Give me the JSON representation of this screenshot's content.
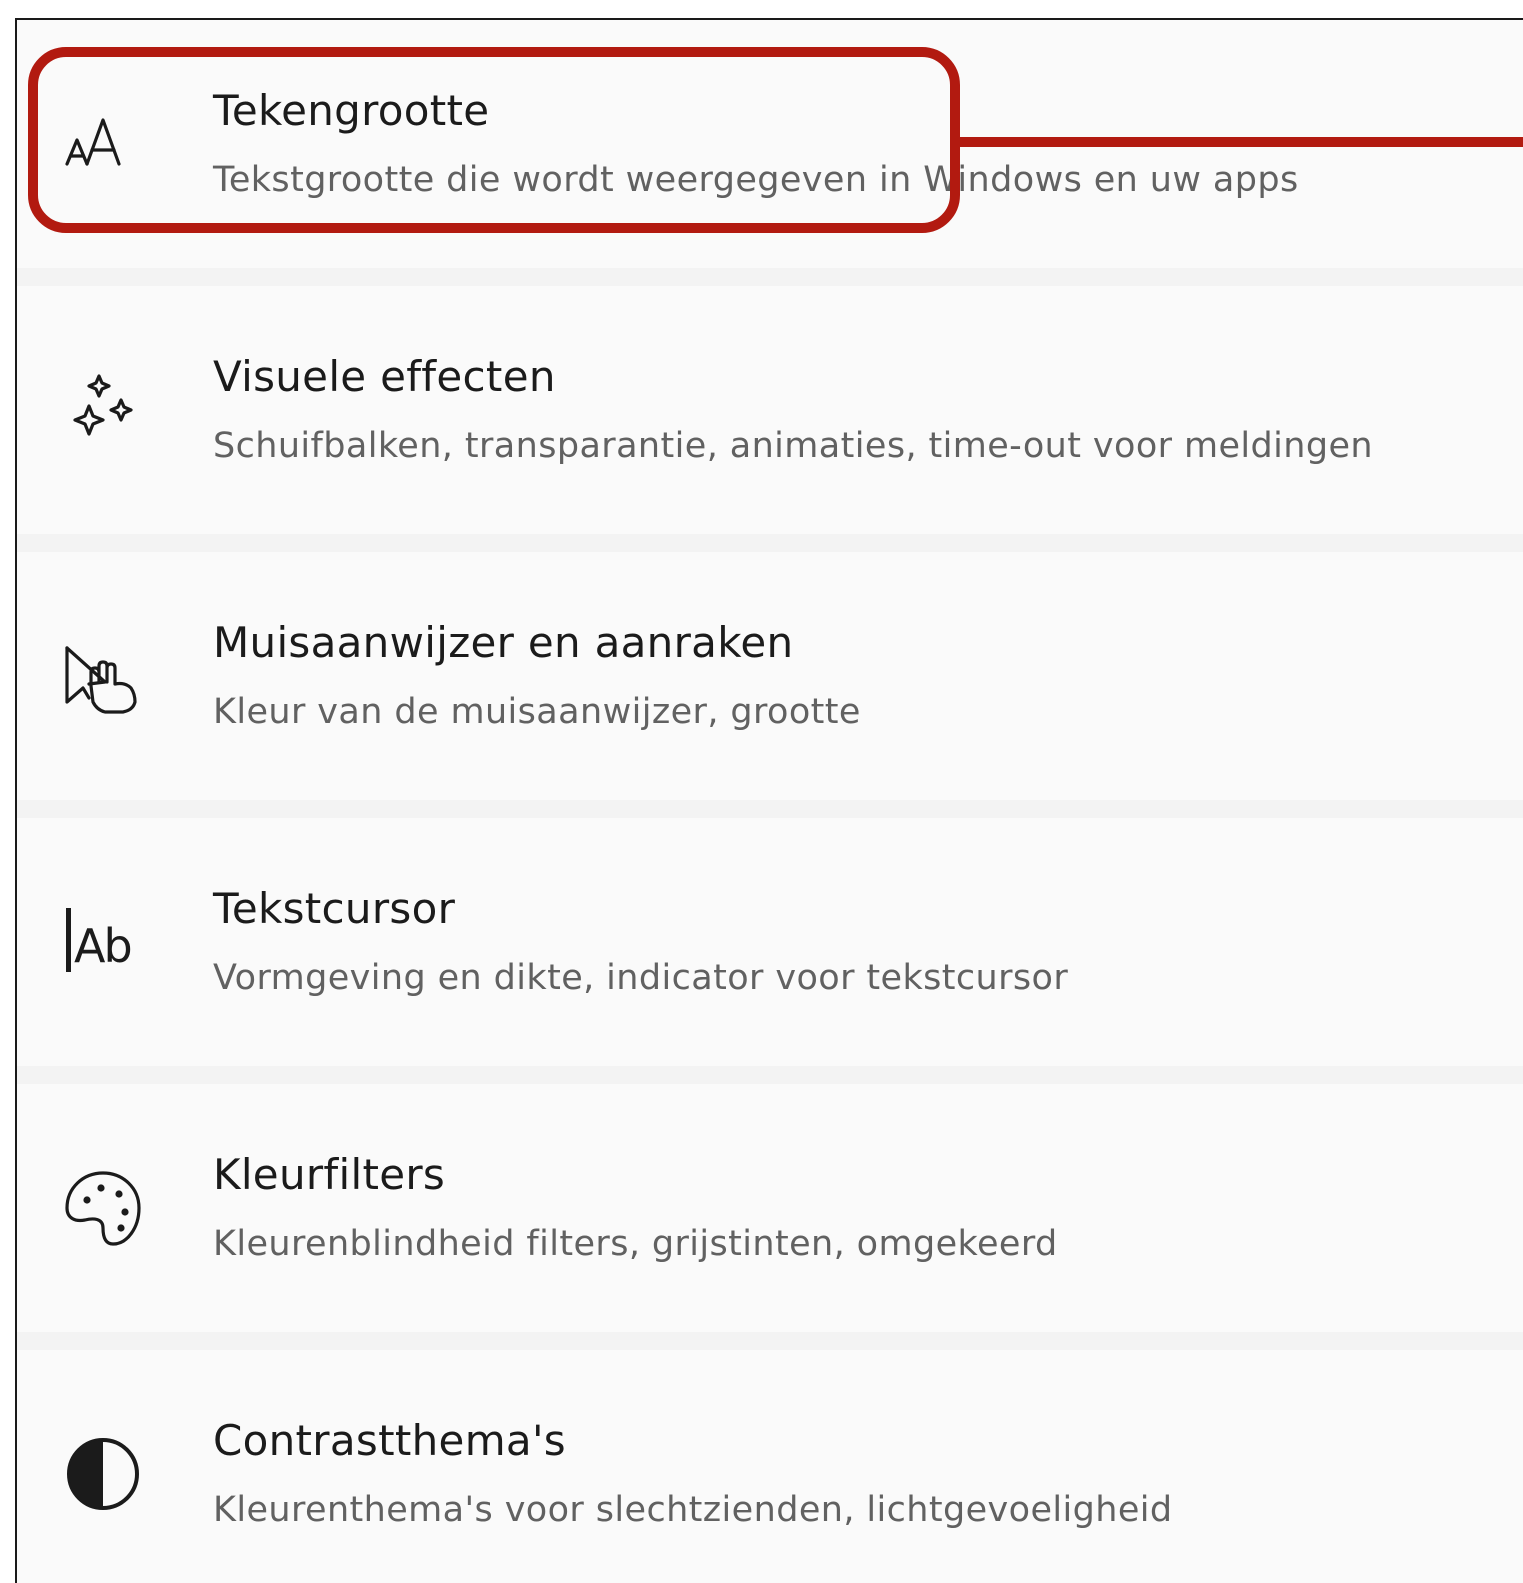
{
  "settings_list": {
    "items": [
      {
        "title": "Tekengrootte",
        "subtitle": "Tekstgrootte die wordt weergegeven in Windows en uw apps",
        "icon": "text-size-icon"
      },
      {
        "title": "Visuele effecten",
        "subtitle": "Schuifbalken, transparantie, animaties, time-out voor meldingen",
        "icon": "sparkle-icon"
      },
      {
        "title": "Muisaanwijzer en aanraken",
        "subtitle": "Kleur van de muisaanwijzer, grootte",
        "icon": "mouse-pointer-touch-icon"
      },
      {
        "title": "Tekstcursor",
        "subtitle": "Vormgeving en dikte, indicator voor tekstcursor",
        "icon": "text-cursor-icon"
      },
      {
        "title": "Kleurfilters",
        "subtitle": "Kleurenblindheid filters, grijstinten, omgekeerd",
        "icon": "palette-icon"
      },
      {
        "title": "Contrastthema's",
        "subtitle": "Kleurenthema's voor slechtzienden, lichtgevoeligheid",
        "icon": "contrast-icon"
      }
    ]
  },
  "annotation": {
    "highlight_color": "#b21a10"
  }
}
